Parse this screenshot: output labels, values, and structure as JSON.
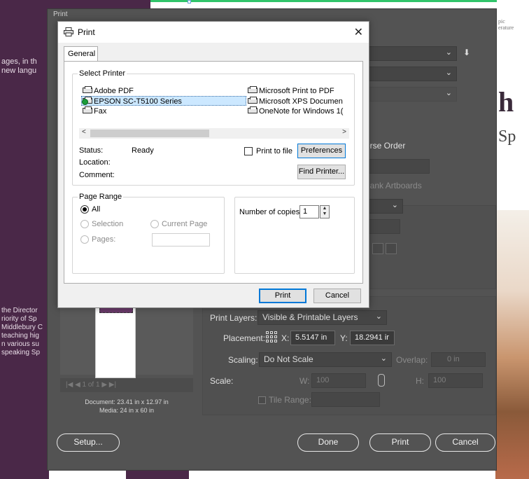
{
  "background": {
    "left_text_top": "ages, in th\nnew langu",
    "left_text_mid": "the Director\nriority of Sp\nMiddlebury C\nteaching hig\nn various su\nspeaking Sp",
    "right_text_top": "pic\nerature",
    "right_big_h": "h",
    "right_sp": "Sp"
  },
  "ai_dialog": {
    "title": "Print",
    "reverse_order_label": "erse Order",
    "blank_artboards_label": "o Blank Artboards",
    "print_layers_label": "Print Layers:",
    "print_layers_value": "Visible & Printable Layers",
    "placement_label": "Placement:",
    "x_label": "X:",
    "x_value": "5.5147 in",
    "y_label": "Y:",
    "y_value": "18.2941 ir",
    "scaling_label": "Scaling:",
    "scaling_value": "Do Not Scale",
    "overlap_label": "Overlap:",
    "overlap_value": "0 in",
    "scale_label": "Scale:",
    "w_label": "W:",
    "w_value": "100",
    "h_label": "H:",
    "h_value": "100",
    "tile_range_label": "Tile Range:",
    "page_nav": "|◀  ◀  1 of 1                    ▶  ▶|",
    "document_info": "Document: 23.41 in x 12.97 in",
    "media_info": "Media: 24 in x 60 in",
    "setup_button": "Setup...",
    "done_button": "Done",
    "print_button": "Print",
    "cancel_button": "Cancel"
  },
  "print_dialog": {
    "title": "Print",
    "close_glyph": "✕",
    "tab_general": "General",
    "select_printer_label": "Select Printer",
    "printers": [
      {
        "name": "Adobe PDF"
      },
      {
        "name": "EPSON SC-T5100 Series"
      },
      {
        "name": "Fax"
      },
      {
        "name": "Microsoft Print to PDF"
      },
      {
        "name": "Microsoft XPS Documen"
      },
      {
        "name": "OneNote for Windows 1("
      }
    ],
    "scroll_left": "<",
    "scroll_right": ">",
    "status_label": "Status:",
    "status_value": "Ready",
    "location_label": "Location:",
    "comment_label": "Comment:",
    "print_to_file_label": "Print to file",
    "preferences_button": "Preferences",
    "find_printer_button": "Find Printer...",
    "page_range_label": "Page Range",
    "range_all": "All",
    "range_selection": "Selection",
    "range_current_page": "Current Page",
    "range_pages": "Pages:",
    "copies_label": "Number of copies:",
    "copies_value": "1",
    "print_button": "Print",
    "cancel_button": "Cancel"
  }
}
